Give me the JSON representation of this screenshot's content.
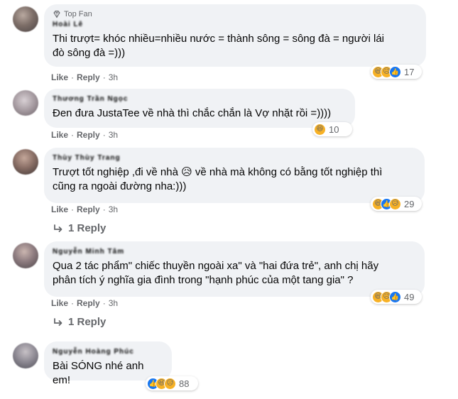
{
  "comments": [
    {
      "top_fan_label": "Top Fan",
      "author": "Hoài Lê",
      "text_lines": [
        "Thi trượt= khóc nhiều=nhiều nước = thành sông = sông đà = người lái",
        "đò sông đà =)))"
      ],
      "like_label": "Like",
      "reply_label": "Reply",
      "time": "3h",
      "reaction_count": "17",
      "reactions": [
        "haha-icon",
        "sad-icon",
        "like-icon"
      ]
    },
    {
      "author": "Thương Trần Ngọc",
      "text_lines": [
        "Đen đưa JustaTee về nhà thì chắc chắn là Vợ nhặt rồi =))))"
      ],
      "like_label": "Like",
      "reply_label": "Reply",
      "time": "3h",
      "reaction_count": "10",
      "reactions": [
        "haha-icon"
      ]
    },
    {
      "author": "Thùy Thùy Trang",
      "text_lines": [
        "Trượt tốt nghiệp ,đi về nhà 😥 về nhà mà không có bằng tốt nghiệp thì",
        "cũng ra ngoài đường nha:)))"
      ],
      "like_label": "Like",
      "reply_label": "Reply",
      "time": "3h",
      "reaction_count": "29",
      "reactions": [
        "haha-icon",
        "like-icon",
        "sad-icon"
      ],
      "replies_label": "1 Reply"
    },
    {
      "author": "Nguyễn Minh Tâm",
      "text_lines": [
        "Qua 2 tác phẩm\" chiếc thuyền ngoài xa\" và \"hai đứa trẻ\", anh chị hãy",
        "phân tích ý nghĩa gia đình trong \"hạnh phúc của một tang gia\" ?"
      ],
      "like_label": "Like",
      "reply_label": "Reply",
      "time": "3h",
      "reaction_count": "49",
      "reactions": [
        "haha-icon",
        "sad-icon",
        "like-icon"
      ],
      "replies_label": "1 Reply"
    },
    {
      "author": "Nguyễn Hoàng Phúc",
      "text_lines": [
        "Bài SÓNG nhé anh em!"
      ],
      "reaction_count": "88",
      "reactions": [
        "like-icon",
        "haha-icon",
        "sad-icon"
      ]
    }
  ],
  "colors": {
    "bubble": "#f0f2f5",
    "meta_text": "#65676b",
    "haha": "#f7b125",
    "like": "#1877f2"
  }
}
